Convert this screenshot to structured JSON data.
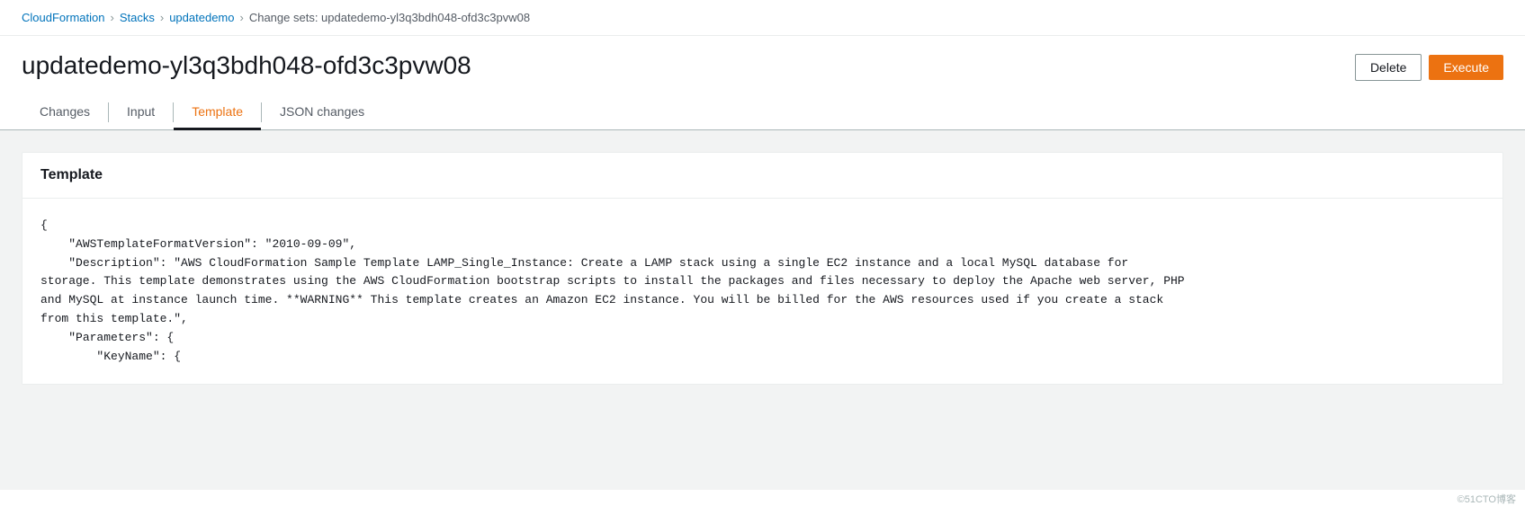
{
  "breadcrumb": {
    "items": [
      {
        "label": "CloudFormation",
        "link": true
      },
      {
        "label": "Stacks",
        "link": true
      },
      {
        "label": "updatedemo",
        "link": true
      },
      {
        "label": "Change sets: updatedemo-yl3q3bdh048-ofd3c3pvw08",
        "link": false
      }
    ],
    "separator": "›"
  },
  "page": {
    "title": "updatedemo-yl3q3bdh048-ofd3c3pvw08",
    "actions": {
      "delete_label": "Delete",
      "execute_label": "Execute"
    }
  },
  "tabs": [
    {
      "id": "changes",
      "label": "Changes",
      "active": false
    },
    {
      "id": "input",
      "label": "Input",
      "active": false
    },
    {
      "id": "template",
      "label": "Template",
      "active": true
    },
    {
      "id": "json-changes",
      "label": "JSON changes",
      "active": false
    }
  ],
  "template_section": {
    "title": "Template",
    "code": "{\n    \"AWSTemplateFormatVersion\": \"2010-09-09\",\n    \"Description\": \"AWS CloudFormation Sample Template LAMP_Single_Instance: Create a LAMP stack using a single EC2 instance and a local MySQL database for\nstorage. This template demonstrates using the AWS CloudFormation bootstrap scripts to install the packages and files necessary to deploy the Apache web server, PHP\nand MySQL at instance launch time. **WARNING** This template creates an Amazon EC2 instance. You will be billed for the AWS resources used if you create a stack\nfrom this template.\",\n    \"Parameters\": {\n        \"KeyName\": {"
  },
  "watermark": {
    "text": "©51CTO博客"
  }
}
